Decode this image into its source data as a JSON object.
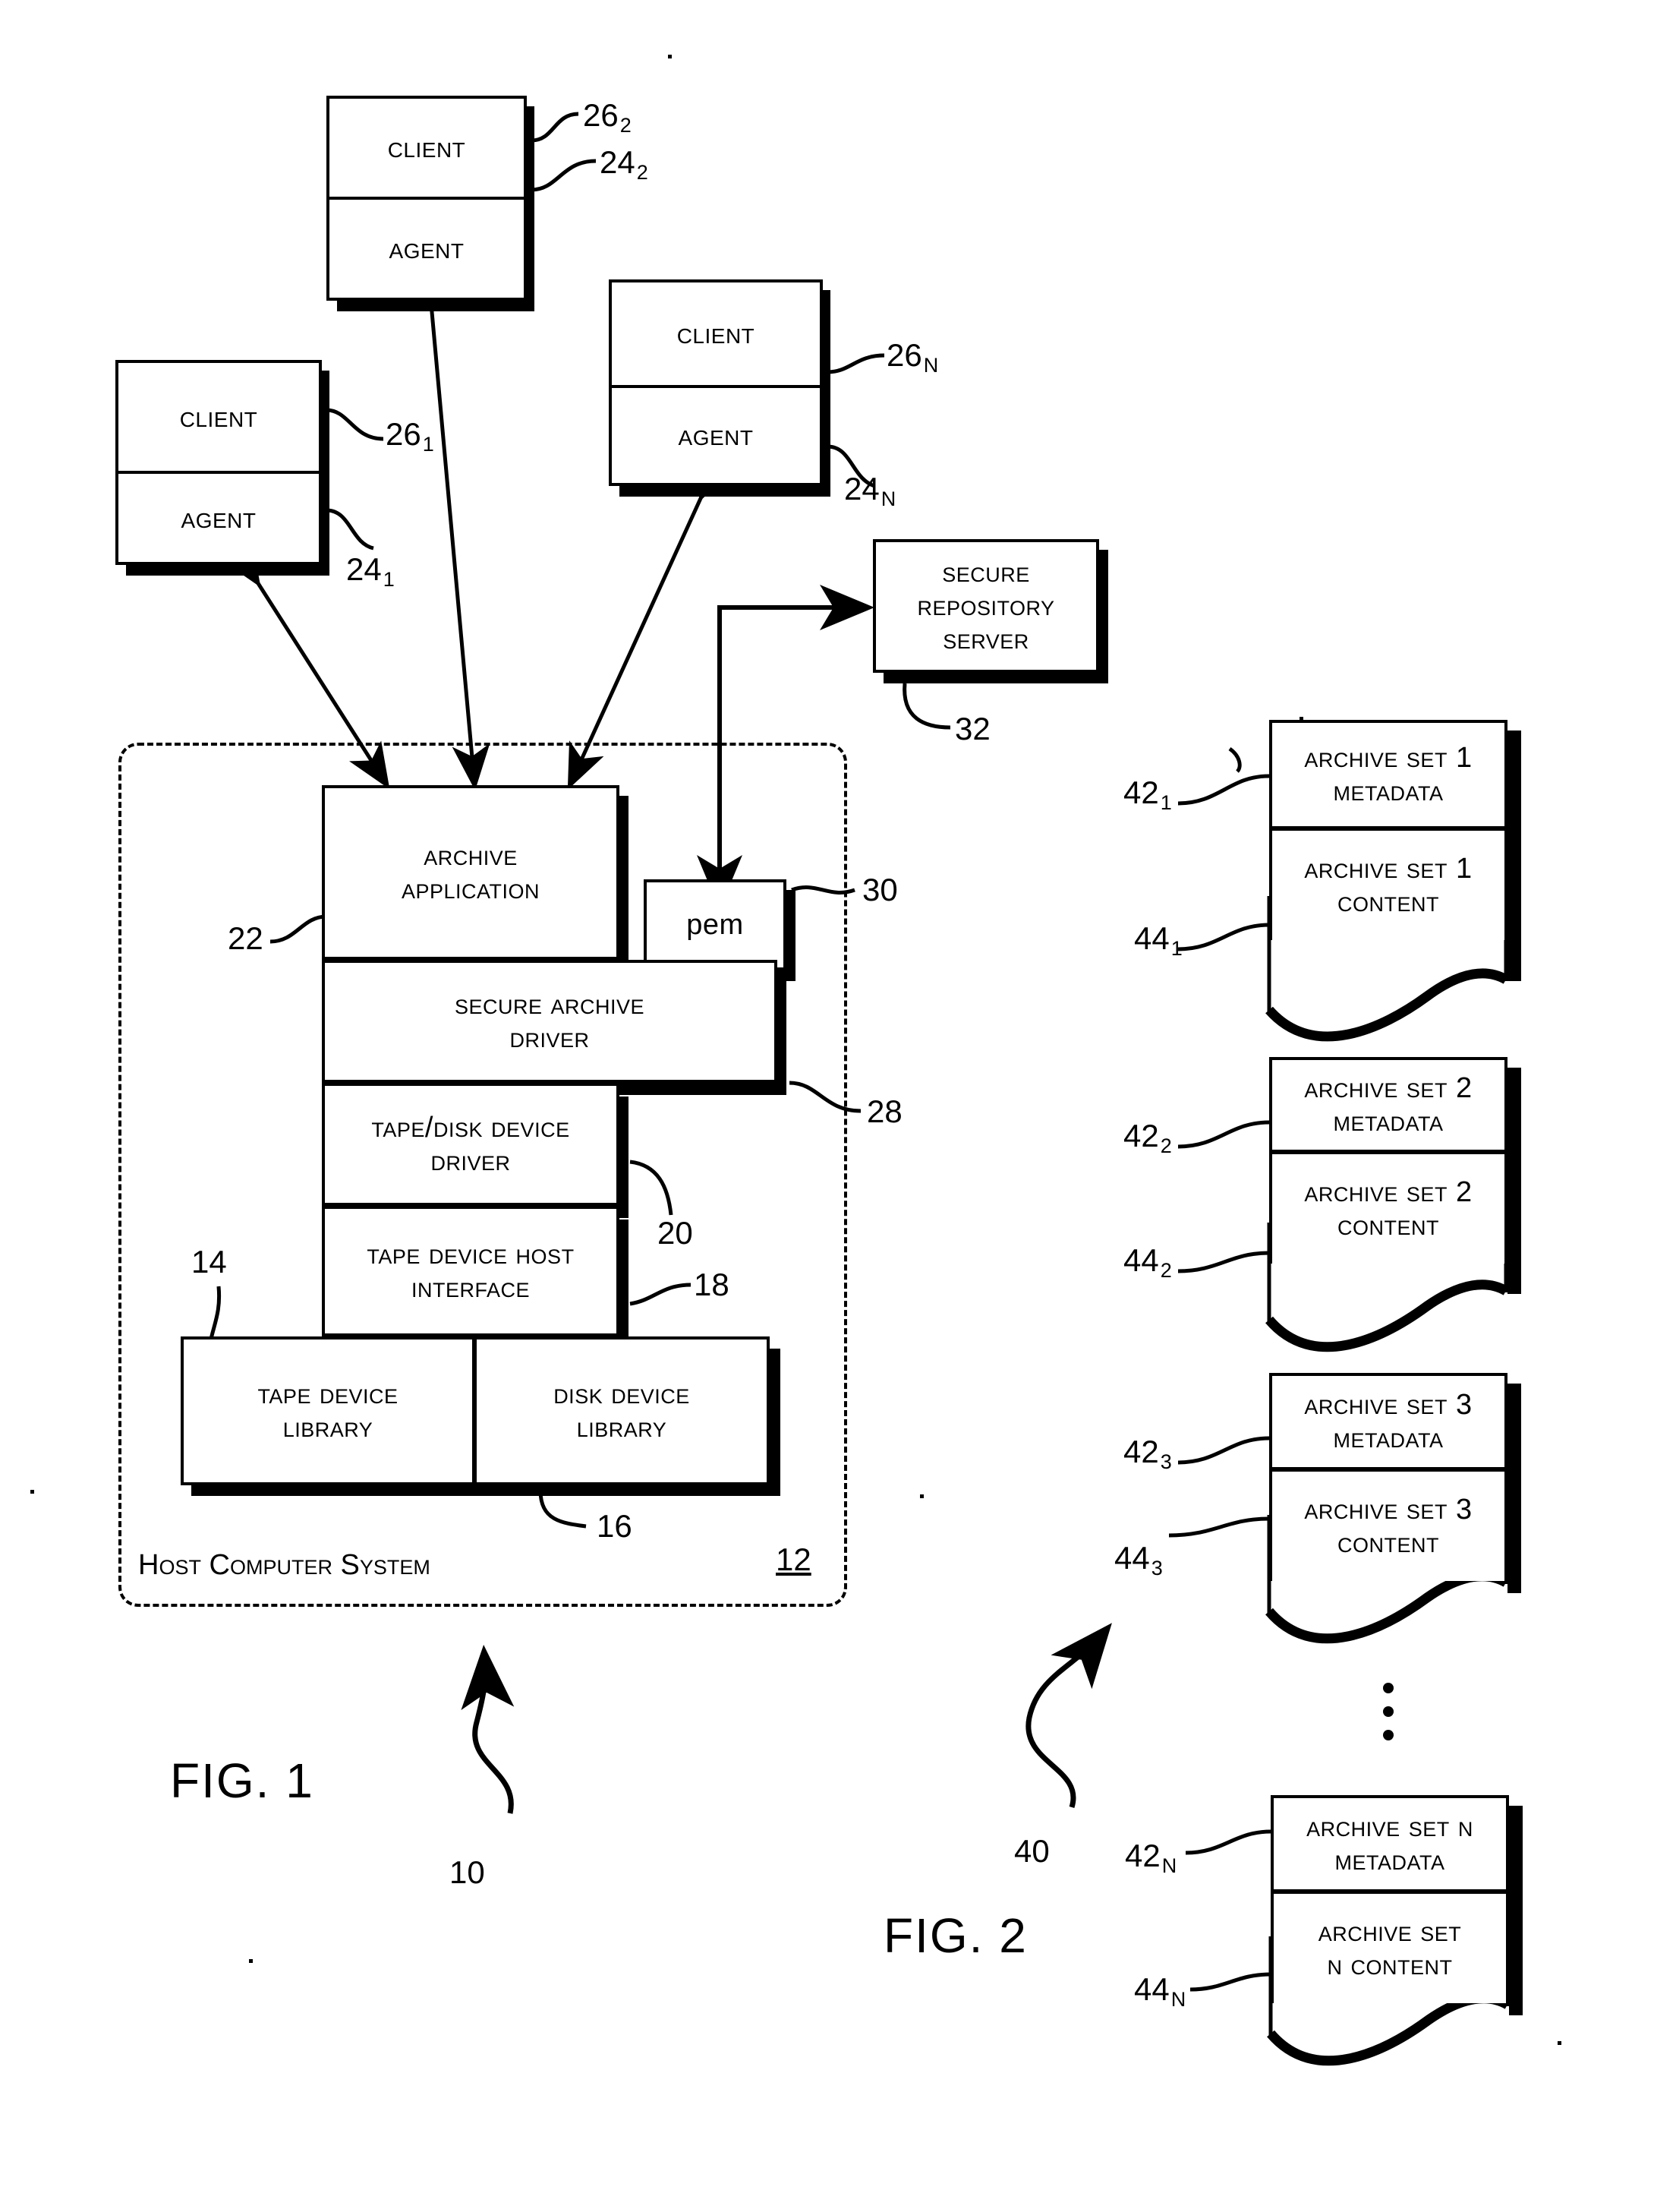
{
  "figures": {
    "fig1": {
      "label": "FIG. 1",
      "system_ref": "10"
    },
    "fig2": {
      "label": "FIG. 2",
      "system_ref": "40"
    }
  },
  "clients": [
    {
      "client_label": "Client",
      "agent_label": "Agent",
      "client_ref": "26",
      "client_sub": "2",
      "agent_ref": "24",
      "agent_sub": "2"
    },
    {
      "client_label": "Client",
      "agent_label": "Agent",
      "client_ref": "26",
      "client_sub": "N",
      "agent_ref": "24",
      "agent_sub": "N"
    },
    {
      "client_label": "Client",
      "agent_label": "Agent",
      "client_ref": "26",
      "client_sub": "1",
      "agent_ref": "24",
      "agent_sub": "1"
    }
  ],
  "secure_repository_server": {
    "line1": "Secure",
    "line2": "Repository",
    "line3": "Server",
    "ref": "32"
  },
  "host_computer_system": {
    "label": "Host Computer System",
    "ref": "12",
    "stack": [
      {
        "name": "archive-application",
        "line1": "Archive",
        "line2": "Application",
        "ref": "22"
      },
      {
        "name": "secure-archive-driver",
        "line1": "Secure Archive",
        "line2": "Driver",
        "ref": "28"
      },
      {
        "name": "tape-disk-device-driver",
        "line1": "Tape/Disk Device",
        "line2": "Driver",
        "ref": "20"
      },
      {
        "name": "tape-device-host-interface",
        "line1": "Tape Device Host",
        "line2": "Interface",
        "ref": "18"
      }
    ],
    "pem": {
      "label": "PEM",
      "ref": "30"
    },
    "libraries": {
      "ref": "16",
      "left_ref": "14",
      "items": [
        {
          "line1": "Tape Device",
          "line2": "Library"
        },
        {
          "line1": "Disk Device",
          "line2": "Library"
        }
      ]
    }
  },
  "archive_sets": [
    {
      "metadata_line1": "Archive Set 1",
      "metadata_line2": "MetaData",
      "content_line1": "Archive Set 1",
      "content_line2": "Content",
      "metadata_ref": "42",
      "metadata_sub": "1",
      "content_ref": "44",
      "content_sub": "1"
    },
    {
      "metadata_line1": "Archive Set 2",
      "metadata_line2": "MetaData",
      "content_line1": "Archive Set 2",
      "content_line2": "Content",
      "metadata_ref": "42",
      "metadata_sub": "2",
      "content_ref": "44",
      "content_sub": "2"
    },
    {
      "metadata_line1": "Archive Set 3",
      "metadata_line2": "MetaData",
      "content_line1": "Archive Set 3",
      "content_line2": "Content",
      "metadata_ref": "42",
      "metadata_sub": "3",
      "content_ref": "44",
      "content_sub": "3"
    },
    {
      "metadata_line1": "Archive Set N",
      "metadata_line2": "MetaData",
      "content_line1": "Archive Set",
      "content_line2": "N Content",
      "metadata_ref": "42",
      "metadata_sub": "N",
      "content_ref": "44",
      "content_sub": "N"
    }
  ],
  "colors": {
    "ink": "#000000",
    "paper": "#ffffff"
  }
}
